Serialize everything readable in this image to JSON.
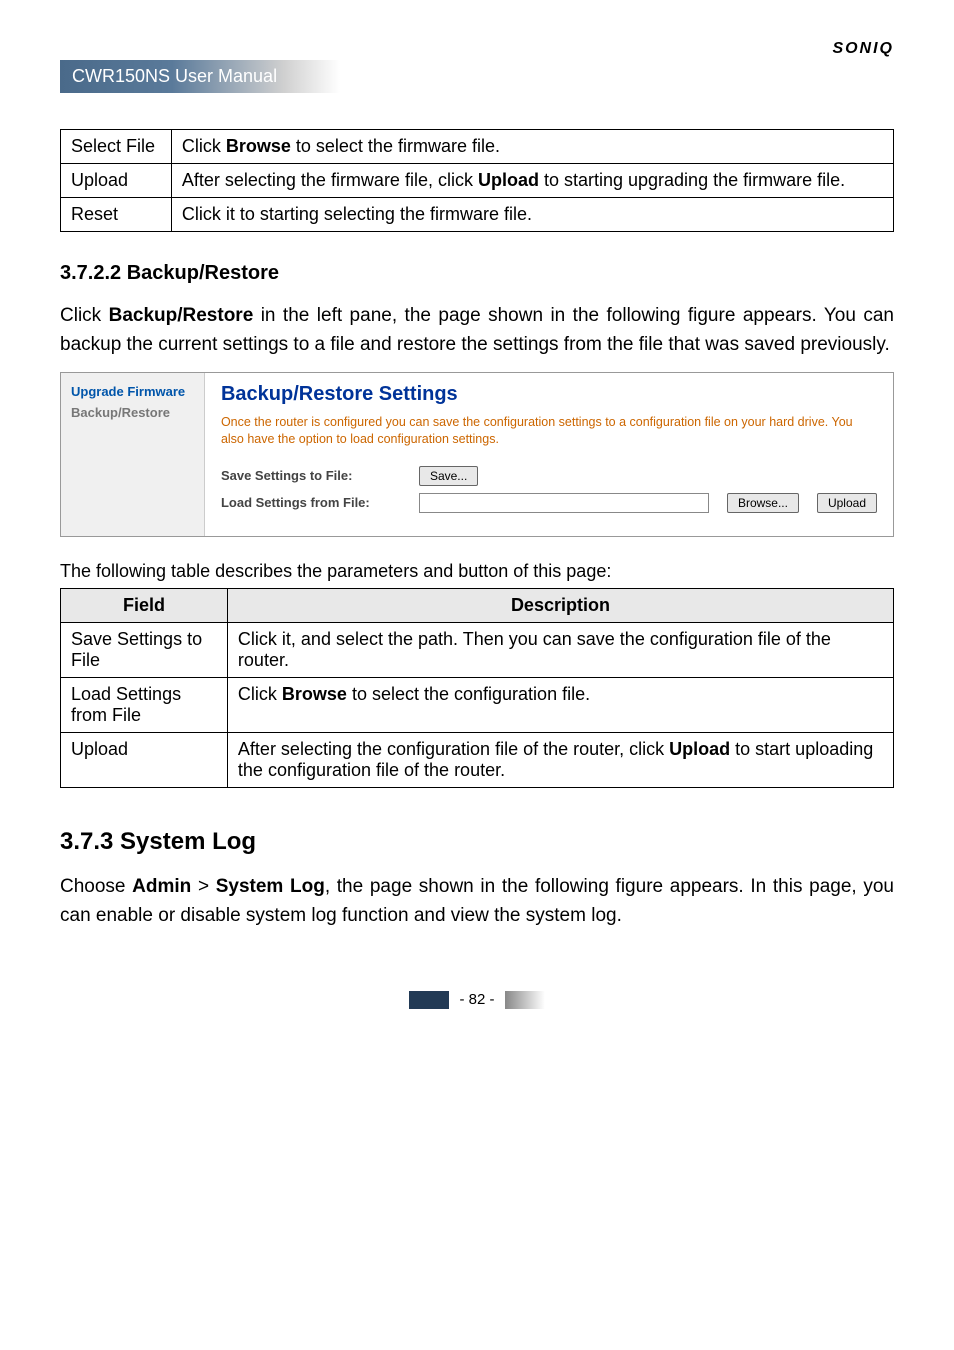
{
  "brand": "SONIQ",
  "header": "CWR150NS User Manual",
  "table1": {
    "rows": [
      {
        "field": "Select File",
        "desc_parts": [
          "Click ",
          "Browse",
          " to select the firmware file."
        ]
      },
      {
        "field": "Upload",
        "desc_parts": [
          "After selecting the firmware file, click ",
          "Upload",
          " to starting upgrading the firmware file."
        ]
      },
      {
        "field": "Reset",
        "desc_parts": [
          "Click it to starting selecting the firmware file."
        ]
      }
    ]
  },
  "section_3_7_2_2": {
    "heading": "3.7.2.2  Backup/Restore",
    "para_parts": [
      "Click ",
      "Backup/Restore",
      " in the left pane, the page shown in the following figure appears. You can backup the current settings to a file and restore the settings from the file that was saved previously."
    ]
  },
  "screenshot": {
    "nav": [
      {
        "label": "Upgrade Firmware",
        "cls": "nav-item"
      },
      {
        "label": "Backup/Restore",
        "cls": "nav-item gray"
      }
    ],
    "title": "Backup/Restore Settings",
    "subtitle": "Once the router is configured you can save the configuration settings to a configuration file on your hard drive. You also have the option to load configuration settings.",
    "row1_label": "Save Settings to File:",
    "row1_button": "Save...",
    "row2_label": "Load Settings from File:",
    "row2_browse": "Browse...",
    "row2_upload": "Upload"
  },
  "table2_caption": "The following table describes the parameters and button of this page:",
  "table2": {
    "head_field": "Field",
    "head_desc": "Description",
    "rows": [
      {
        "field": "Save Settings to File",
        "desc_parts": [
          "Click it, and select the path. Then you can save the configuration file of the router."
        ]
      },
      {
        "field": "Load Settings from File",
        "desc_parts": [
          "Click ",
          "Browse",
          " to select the configuration file."
        ]
      },
      {
        "field": "Upload",
        "desc_parts": [
          "After selecting the configuration file of the router, click ",
          "Upload",
          " to start uploading the configuration file of the router."
        ]
      }
    ]
  },
  "section_3_7_3": {
    "heading": "3.7.3  System Log",
    "para_parts": [
      "Choose ",
      "Admin",
      " > ",
      "System Log",
      ", the page shown in the following figure appears. In this page, you can enable or disable system log function and view the system log."
    ]
  },
  "page_number": "- 82 -"
}
